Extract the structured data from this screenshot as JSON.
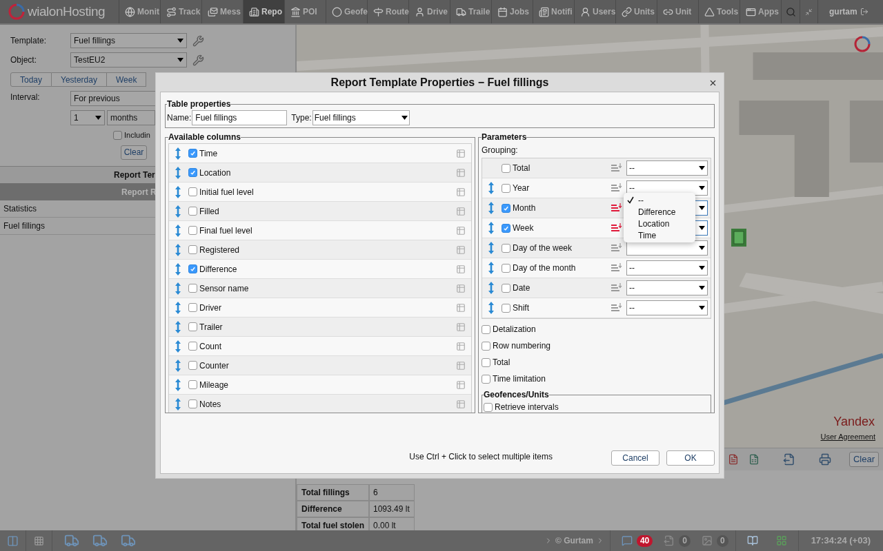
{
  "top_nav": {
    "logo": "wialonHosting",
    "items": [
      {
        "label": "Monit",
        "selected": false
      },
      {
        "label": "Track",
        "selected": false
      },
      {
        "label": "Mess",
        "selected": false
      },
      {
        "label": "Repo",
        "selected": true
      },
      {
        "label": "POI",
        "selected": false
      },
      {
        "label": "Geofe",
        "selected": false
      },
      {
        "label": "Route",
        "selected": false
      },
      {
        "label": "Drive",
        "selected": false
      },
      {
        "label": "Traile",
        "selected": false
      },
      {
        "label": "Jobs",
        "selected": false
      },
      {
        "label": "Notifi",
        "selected": false
      },
      {
        "label": "Users",
        "selected": false
      },
      {
        "label": "Units",
        "selected": false
      },
      {
        "label": "Unit",
        "selected": false
      },
      {
        "label": "Tools",
        "selected": false
      },
      {
        "label": "Apps",
        "selected": false
      }
    ],
    "user": "gurtam"
  },
  "report_panel": {
    "template_label": "Template:",
    "template": "Fuel fillings",
    "object_label": "Object:",
    "object": "TestEU2",
    "period_tabs": [
      {
        "label": "Today",
        "selected": false
      },
      {
        "label": "Yesterday",
        "selected": false
      },
      {
        "label": "Week",
        "selected": false
      }
    ],
    "interval_label": "Interval:",
    "interval": "For previous",
    "count": "1",
    "unit": "months",
    "including": {
      "label": "Includin",
      "checked": false
    },
    "clear": "Clear",
    "templates_header": "Report Ter",
    "results_header": "Report R",
    "results": [
      "Statistics",
      "Fuel fillings"
    ]
  },
  "map": {
    "yandex": "Yandex",
    "agreement": "User Agreement"
  },
  "result_toolbar": {
    "clear": "Clear"
  },
  "statistics": [
    {
      "name": "Total fillings",
      "value": "6"
    },
    {
      "name": "Difference",
      "value": "1093.49 lt"
    },
    {
      "name": "Total fuel stolen",
      "value": "0.00 lt"
    }
  ],
  "status_bar": {
    "copyright": "© Gurtam",
    "messages": "40",
    "commands": "0",
    "images": "0",
    "time": "17:34:24 (+03)"
  },
  "dialog": {
    "title": "Report Template Properties − Fuel fillings",
    "table_properties": {
      "legend": "Table properties",
      "name_label": "Name:",
      "name": "Fuel fillings",
      "type_label": "Type:",
      "type": "Fuel fillings"
    },
    "columns": {
      "legend": "Available columns",
      "items": [
        {
          "label": "Time",
          "checked": true
        },
        {
          "label": "Location",
          "checked": true
        },
        {
          "label": "Initial fuel level",
          "checked": false
        },
        {
          "label": "Filled",
          "checked": false
        },
        {
          "label": "Final fuel level",
          "checked": false
        },
        {
          "label": "Registered",
          "checked": false
        },
        {
          "label": "Difference",
          "checked": true
        },
        {
          "label": "Sensor name",
          "checked": false
        },
        {
          "label": "Driver",
          "checked": false
        },
        {
          "label": "Trailer",
          "checked": false
        },
        {
          "label": "Count",
          "checked": false
        },
        {
          "label": "Counter",
          "checked": false
        },
        {
          "label": "Mileage",
          "checked": false
        },
        {
          "label": "Notes",
          "checked": false
        }
      ]
    },
    "parameters": {
      "legend": "Parameters",
      "grouping_label": "Grouping:",
      "grouping": [
        {
          "label": "Total",
          "checked": false,
          "draggable": false,
          "sort": "--"
        },
        {
          "label": "Year",
          "checked": false,
          "draggable": true,
          "sort": "--"
        },
        {
          "label": "Month",
          "checked": true,
          "draggable": true
        },
        {
          "label": "Week",
          "checked": true,
          "draggable": true
        },
        {
          "label": "Day of the week",
          "checked": false,
          "draggable": true
        },
        {
          "label": "Day of the month",
          "checked": false,
          "draggable": true,
          "sort": "--"
        },
        {
          "label": "Date",
          "checked": false,
          "draggable": true,
          "sort": "--"
        },
        {
          "label": "Shift",
          "checked": false,
          "draggable": true,
          "sort": "--"
        }
      ],
      "options": [
        {
          "label": "Detalization",
          "checked": false
        },
        {
          "label": "Row numbering",
          "checked": false
        },
        {
          "label": "Total",
          "checked": false
        },
        {
          "label": "Time limitation",
          "checked": false
        }
      ],
      "geofences": {
        "legend": "Geofences/Units",
        "retrieve": {
          "label": "Retrieve intervals",
          "checked": false
        }
      }
    },
    "dropdown": {
      "items": [
        {
          "label": "--",
          "selected": true
        },
        {
          "label": "Difference",
          "selected": false
        },
        {
          "label": "Location",
          "selected": false
        },
        {
          "label": "Time",
          "selected": false
        }
      ]
    },
    "hint": "Use Ctrl + Click to select multiple items",
    "buttons": [
      "Cancel",
      "OK"
    ]
  }
}
